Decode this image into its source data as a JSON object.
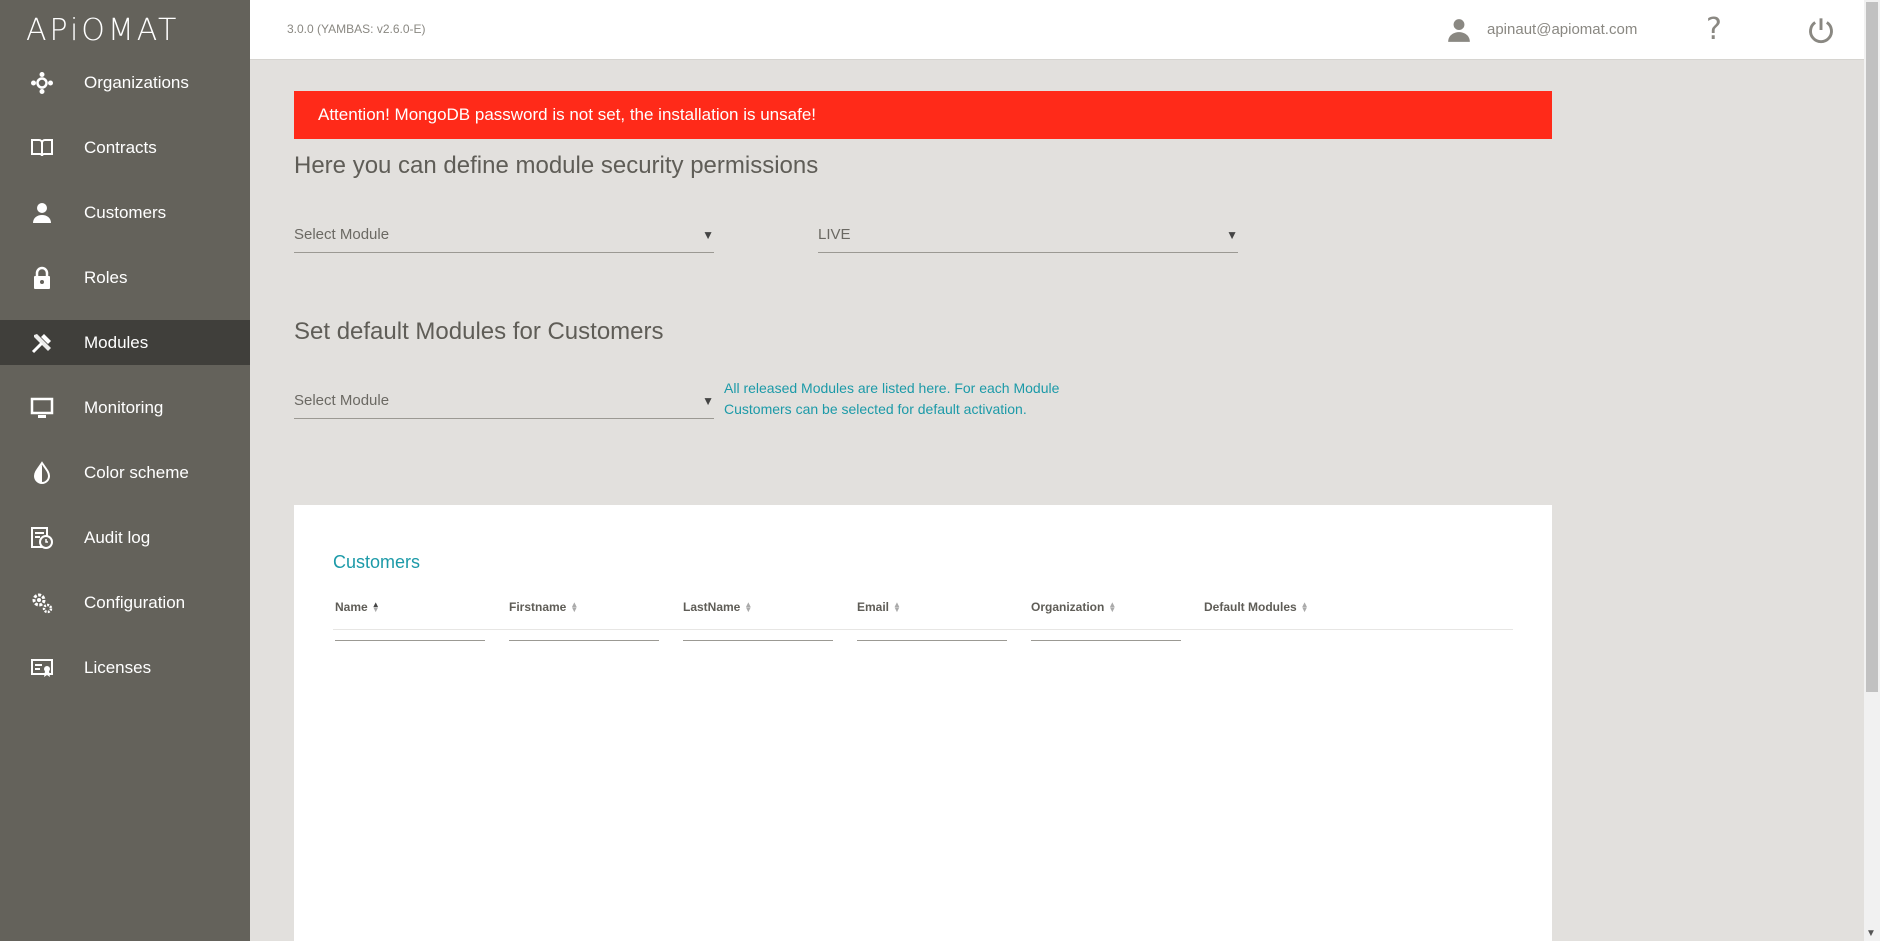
{
  "app": {
    "logo_text": "APiOMAT",
    "version": "3.0.0 (YAMBAS: v2.6.0-E)",
    "user_email": "apinaut@apiomat.com",
    "help_glyph": "?"
  },
  "sidebar": {
    "items": [
      {
        "label": "Organizations",
        "icon": "organizations-icon"
      },
      {
        "label": "Contracts",
        "icon": "book-icon"
      },
      {
        "label": "Customers",
        "icon": "person-icon"
      },
      {
        "label": "Roles",
        "icon": "lock-icon"
      },
      {
        "label": "Modules",
        "icon": "tools-icon",
        "active": true
      },
      {
        "label": "Monitoring",
        "icon": "monitor-icon"
      },
      {
        "label": "Color scheme",
        "icon": "drop-icon"
      },
      {
        "label": "Audit log",
        "icon": "audit-icon"
      },
      {
        "label": "Configuration",
        "icon": "gears-icon"
      },
      {
        "label": "Licenses",
        "icon": "license-icon"
      }
    ]
  },
  "main": {
    "alert": "Attention! MongoDB password is not set, the installation is unsafe!",
    "security_title": "Here you can define module security permissions",
    "security_module_select": "Select Module",
    "security_system_select": "LIVE",
    "defaults_title": "Set default Modules for Customers",
    "defaults_module_select": "Select Module",
    "defaults_hint": "All released Modules are listed here. For each Module Customers can be selected for default activation.",
    "caret": "▼"
  },
  "customers_table": {
    "title": "Customers",
    "columns": [
      "Name",
      "Firstname",
      "LastName",
      "Email",
      "Organization",
      "Default Modules"
    ],
    "sorted_column": "Name",
    "sort_direction": "ascending"
  },
  "colors": {
    "sidebar": "#64625b",
    "sidebar_active": "#403f3b",
    "alert": "#ff2a19",
    "accent": "#1c9aa8",
    "background": "#e2e0dd"
  }
}
